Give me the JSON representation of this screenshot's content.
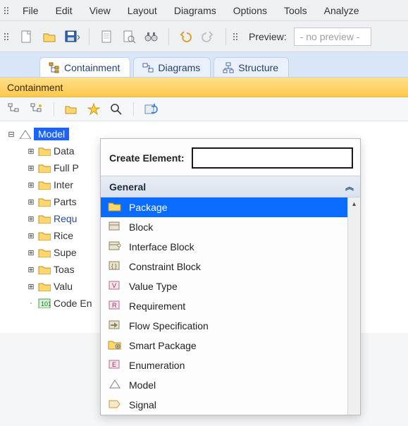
{
  "menubar": [
    "File",
    "Edit",
    "View",
    "Layout",
    "Diagrams",
    "Options",
    "Tools",
    "Analyze"
  ],
  "toolbar": {
    "preview_label": "Preview:",
    "preview_value": "- no preview -"
  },
  "tabs": [
    {
      "label": "Containment",
      "active": true,
      "icon": "tree"
    },
    {
      "label": "Diagrams",
      "active": false,
      "icon": "diagram"
    },
    {
      "label": "Structure",
      "active": false,
      "icon": "structure"
    }
  ],
  "panel": {
    "title": "Containment"
  },
  "tree": {
    "root": {
      "label": "Model",
      "icon": "model",
      "expanded": true
    },
    "children": [
      {
        "label": "Data",
        "icon": "folder"
      },
      {
        "label": "Full P",
        "icon": "folder"
      },
      {
        "label": "Inter",
        "icon": "folder"
      },
      {
        "label": "Parts",
        "icon": "folder"
      },
      {
        "label": "Requ",
        "icon": "folder",
        "link": true
      },
      {
        "label": "Rice",
        "icon": "folder"
      },
      {
        "label": "Supe",
        "icon": "folder"
      },
      {
        "label": "Toas",
        "icon": "folder"
      },
      {
        "label": "Valu",
        "icon": "folder"
      },
      {
        "label": "Code En",
        "icon": "code",
        "leaf": true
      }
    ]
  },
  "popup": {
    "label": "Create Element:",
    "input_value": "",
    "category": "General",
    "items": [
      {
        "label": "Package",
        "icon": "package",
        "selected": true
      },
      {
        "label": "Block",
        "icon": "block"
      },
      {
        "label": "Interface Block",
        "icon": "iblock"
      },
      {
        "label": "Constraint Block",
        "icon": "cblock"
      },
      {
        "label": "Value Type",
        "icon": "vtype"
      },
      {
        "label": "Requirement",
        "icon": "req"
      },
      {
        "label": "Flow Specification",
        "icon": "flow"
      },
      {
        "label": "Smart Package",
        "icon": "spkg"
      },
      {
        "label": "Enumeration",
        "icon": "enum"
      },
      {
        "label": "Model",
        "icon": "model"
      },
      {
        "label": "Signal",
        "icon": "signal"
      }
    ]
  }
}
